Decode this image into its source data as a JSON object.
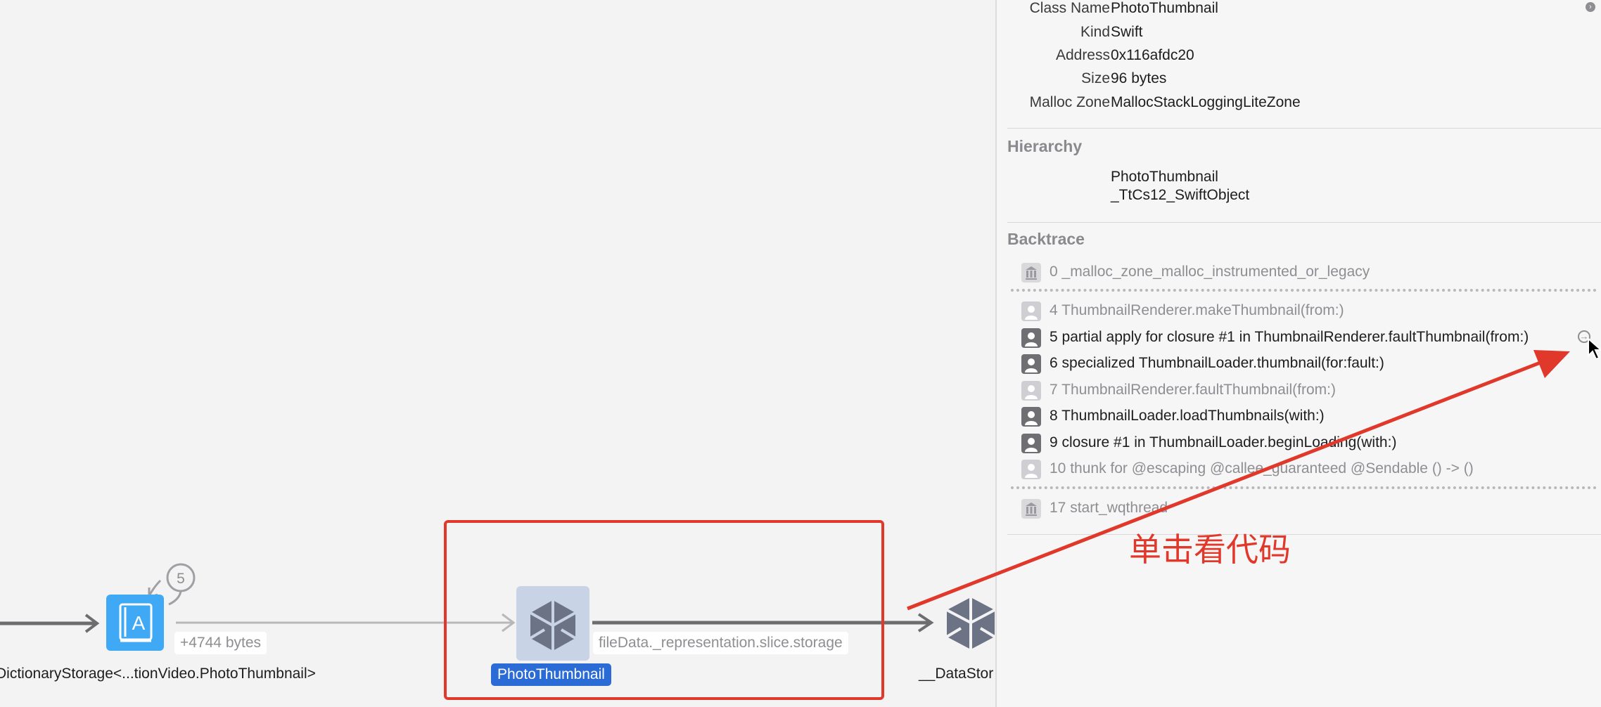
{
  "graph": {
    "left_node": {
      "label": "DictionaryStorage<...tionVideo.PhotoThumbnail>",
      "badge_count": "5",
      "edge_label": "+4744 bytes"
    },
    "selected_node": {
      "label": "PhotoThumbnail",
      "edge_label": "fileData._representation.slice.storage"
    },
    "right_node": {
      "label": "__DataStor"
    }
  },
  "inspector": {
    "properties": [
      {
        "key": "Class Name",
        "value": "PhotoThumbnail"
      },
      {
        "key": "Kind",
        "value": "Swift"
      },
      {
        "key": "Address",
        "value": "0x116afdc20"
      },
      {
        "key": "Size",
        "value": "96 bytes"
      },
      {
        "key": "Malloc Zone",
        "value": "MallocStackLoggingLiteZone"
      }
    ],
    "hierarchy_title": "Hierarchy",
    "hierarchy": [
      "PhotoThumbnail",
      "_TtCs12_SwiftObject"
    ],
    "backtrace_title": "Backtrace",
    "backtrace": [
      {
        "text": "0 _malloc_zone_malloc_instrumented_or_legacy",
        "icon": "library-icon",
        "dim": true
      },
      {
        "text": "4 ThumbnailRenderer.makeThumbnail(from:)",
        "icon": "user-icon",
        "dim": true
      },
      {
        "text": "5 partial apply for closure #1 in ThumbnailRenderer.faultThumbnail(from:)",
        "icon": "user-icon",
        "dim": false
      },
      {
        "text": "6 specialized ThumbnailLoader.thumbnail(for:fault:)",
        "icon": "user-icon",
        "dim": false
      },
      {
        "text": "7 ThumbnailRenderer.faultThumbnail(from:)",
        "icon": "user-icon",
        "dim": true
      },
      {
        "text": "8 ThumbnailLoader.loadThumbnails(with:)",
        "icon": "user-icon",
        "dim": false
      },
      {
        "text": "9 closure #1 in ThumbnailLoader.beginLoading(with:)",
        "icon": "user-icon",
        "dim": false
      },
      {
        "text": "10 thunk for @escaping @callee_guaranteed @Sendable () -> ()",
        "icon": "user-icon",
        "dim": true
      },
      {
        "text": "17 start_wqthread",
        "icon": "library-icon",
        "dim": true
      }
    ]
  },
  "annotation": {
    "text": "单击看代码",
    "color": "#e0392b"
  },
  "colors": {
    "selection_blue": "#2a6bd6",
    "annotation_red": "#e0392b"
  }
}
